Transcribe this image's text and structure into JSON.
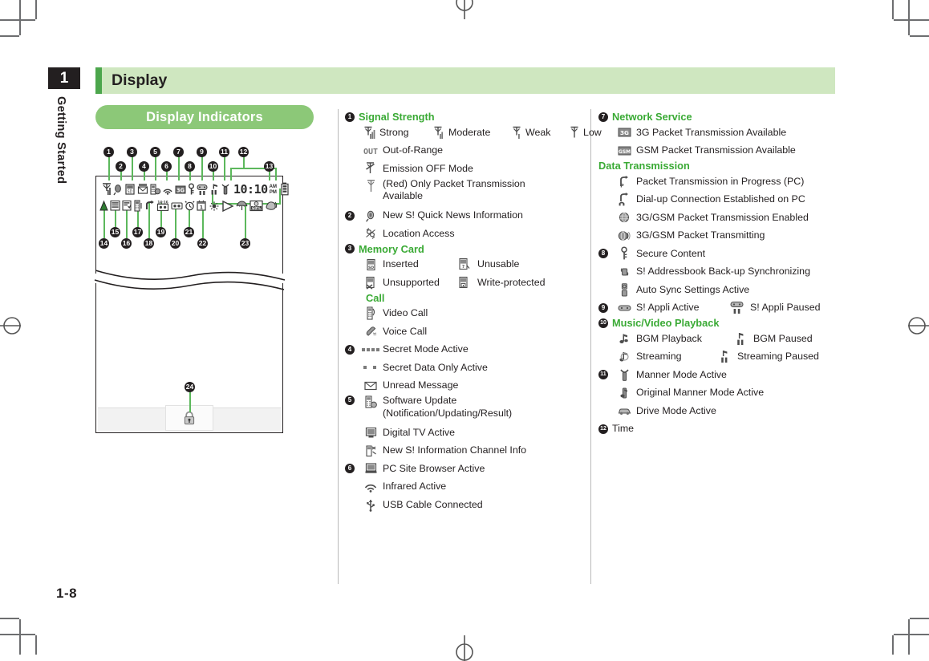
{
  "page": {
    "chapter_number": "1",
    "chapter_name": "Getting Started",
    "header_title": "Display",
    "section_title": "Display Indicators",
    "page_number": "1-8",
    "accent_green": "#4ca64c",
    "header_band": "#cfe7c0",
    "pill_green": "#8cc878",
    "heading_green": "#3aaa35",
    "leader_green": "#5cb85c"
  },
  "figure": {
    "name": "handset-display-indicators",
    "callout_numbers_top": [
      "1",
      "2",
      "3",
      "4",
      "5",
      "6",
      "7",
      "8",
      "9",
      "10",
      "11",
      "12",
      "13"
    ],
    "callout_numbers_bottom": [
      "14",
      "15",
      "16",
      "17",
      "18",
      "19",
      "20",
      "21",
      "22",
      "23"
    ],
    "callout_number_softkey": "24",
    "screen_row1_icons": [
      "signal-strength-icon",
      "s-quick-news-icon",
      "memory-card-icon",
      "unread-message-icon",
      "software-update-icon",
      "infrared-icon",
      "3g-icon",
      "secure-content-icon",
      "s-appli-paused-icon",
      "bgm-paused-icon",
      "manner-mode-icon"
    ],
    "screen_time": "10:10",
    "screen_time_ampm_top": "AM",
    "screen_time_ampm_bottom": "PM",
    "screen_row1_battery": "battery-icon",
    "screen_row2_icons": [
      "emission-off-icon",
      "calendar-note-icon",
      "task-icon",
      "vibration-icon",
      "call-forward-icon",
      "world-clock-icon",
      "answer-machine-icon",
      "alarm-icon",
      "schedule-icon",
      "brightness-icon",
      "play-icon",
      "umbrella-icon",
      "battery-percent-icon",
      "sound-icon"
    ],
    "screen_row2_battery_percent": "60%",
    "screen_row2_worldclock_label": "14:16",
    "screen_row2_schedule_label": "1",
    "softkey_icon": "lock-icon"
  },
  "legend": {
    "middle": [
      {
        "type": "group",
        "badge": "1",
        "title": "Signal Strength",
        "rows": [
          {
            "type": "quad",
            "items": [
              {
                "icon": "signal-strong-icon",
                "label": "Strong"
              },
              {
                "icon": "signal-moderate-icon",
                "label": "Moderate"
              },
              {
                "icon": "signal-weak-icon",
                "label": "Weak"
              },
              {
                "icon": "signal-low-icon",
                "label": "Low"
              }
            ]
          },
          {
            "type": "single",
            "icon": "out-of-range-icon",
            "label": "Out-of-Range"
          },
          {
            "type": "single",
            "icon": "emission-off-icon",
            "label": "Emission OFF Mode"
          },
          {
            "type": "single",
            "icon": "packet-only-icon",
            "label": "(Red) Only Packet Transmission",
            "label2": "Available"
          }
        ]
      },
      {
        "type": "plain",
        "badge": "2",
        "rows": [
          {
            "type": "single",
            "icon": "s-quick-news-icon",
            "label": "New S! Quick News Information"
          },
          {
            "type": "single",
            "icon": "location-access-icon",
            "label": "Location Access"
          }
        ]
      },
      {
        "type": "group",
        "badge": "3",
        "title": "Memory Card",
        "rows": [
          {
            "type": "double",
            "left": {
              "icon": "card-inserted-icon",
              "label": "Inserted"
            },
            "right": {
              "icon": "card-unusable-icon",
              "label": "Unusable"
            }
          },
          {
            "type": "double",
            "left": {
              "icon": "card-unsupported-icon",
              "label": "Unsupported"
            },
            "right": {
              "icon": "card-write-protected-icon",
              "label": "Write-protected"
            }
          }
        ]
      },
      {
        "type": "group",
        "badge": "",
        "title": "Call",
        "rows": [
          {
            "type": "single",
            "icon": "video-call-icon",
            "label": "Video Call"
          },
          {
            "type": "single",
            "icon": "voice-call-icon",
            "label": "Voice Call"
          }
        ]
      },
      {
        "type": "plain",
        "badge": "4",
        "rows": [
          {
            "type": "single",
            "icon": "secret-mode-icon",
            "label": "Secret Mode Active"
          },
          {
            "type": "single",
            "icon": "secret-data-icon",
            "label": "Secret Data Only Active"
          },
          {
            "type": "single",
            "icon": "unread-message-icon",
            "label": "Unread Message"
          }
        ]
      },
      {
        "type": "plain",
        "badge": "5",
        "rows": [
          {
            "type": "single",
            "icon": "software-update-icon",
            "label": "Software Update",
            "label2": "(Notification/Updating/Result)"
          },
          {
            "type": "single",
            "icon": "digital-tv-icon",
            "label": "Digital TV Active"
          },
          {
            "type": "single",
            "icon": "s-information-channel-icon",
            "label": "New S! Information Channel Info"
          }
        ]
      },
      {
        "type": "plain",
        "badge": "6",
        "rows": [
          {
            "type": "single",
            "icon": "pc-site-browser-icon",
            "label": "PC Site Browser Active"
          },
          {
            "type": "single",
            "icon": "infrared-icon",
            "label": "Infrared Active"
          },
          {
            "type": "single",
            "icon": "usb-cable-icon",
            "label": "USB Cable Connected"
          }
        ]
      }
    ],
    "right": [
      {
        "type": "group",
        "badge": "7",
        "title": "Network Service",
        "rows": [
          {
            "type": "single",
            "icon": "3g-icon",
            "label": "3G Packet Transmission Available"
          },
          {
            "type": "single",
            "icon": "gsm-icon",
            "label": "GSM Packet Transmission Available"
          }
        ]
      },
      {
        "type": "group",
        "badge": "",
        "title": "Data Transmission",
        "rows": [
          {
            "type": "single",
            "icon": "packet-progress-pc-icon",
            "label": "Packet Transmission in Progress (PC)"
          },
          {
            "type": "single",
            "icon": "dialup-pc-icon",
            "label": "Dial-up Connection Established on PC"
          },
          {
            "type": "single",
            "icon": "packet-enabled-icon",
            "label": "3G/GSM Packet Transmission Enabled"
          },
          {
            "type": "single",
            "icon": "packet-transmitting-icon",
            "label": "3G/GSM Packet Transmitting"
          }
        ]
      },
      {
        "type": "plain",
        "badge": "8",
        "rows": [
          {
            "type": "single",
            "icon": "secure-content-icon",
            "label": "Secure Content"
          },
          {
            "type": "single",
            "icon": "addressbook-backup-icon",
            "label": "S! Addressbook Back-up Synchronizing"
          },
          {
            "type": "single",
            "icon": "auto-sync-icon",
            "label": "Auto Sync Settings Active"
          }
        ]
      },
      {
        "type": "plain",
        "badge": "9",
        "rows": [
          {
            "type": "double",
            "left": {
              "icon": "s-appli-active-icon",
              "label": "S! Appli Active"
            },
            "right": {
              "icon": "s-appli-paused-icon",
              "label": "S! Appli Paused"
            }
          }
        ]
      },
      {
        "type": "group",
        "badge": "10",
        "title": "Music/Video Playback",
        "rows": [
          {
            "type": "double",
            "left": {
              "icon": "bgm-playback-icon",
              "label": "BGM Playback"
            },
            "right": {
              "icon": "bgm-paused-icon",
              "label": "BGM Paused"
            }
          },
          {
            "type": "double",
            "left": {
              "icon": "streaming-icon",
              "label": "Streaming"
            },
            "right": {
              "icon": "streaming-paused-icon",
              "label": "Streaming Paused"
            }
          }
        ]
      },
      {
        "type": "plain",
        "badge": "11",
        "rows": [
          {
            "type": "single",
            "icon": "manner-mode-icon",
            "label": "Manner Mode Active"
          },
          {
            "type": "single",
            "icon": "original-manner-mode-icon",
            "label": "Original Manner Mode Active"
          },
          {
            "type": "single",
            "icon": "drive-mode-icon",
            "label": "Drive Mode Active"
          }
        ]
      },
      {
        "type": "plain-inline",
        "badge": "12",
        "title": "Time",
        "rows": []
      }
    ]
  }
}
